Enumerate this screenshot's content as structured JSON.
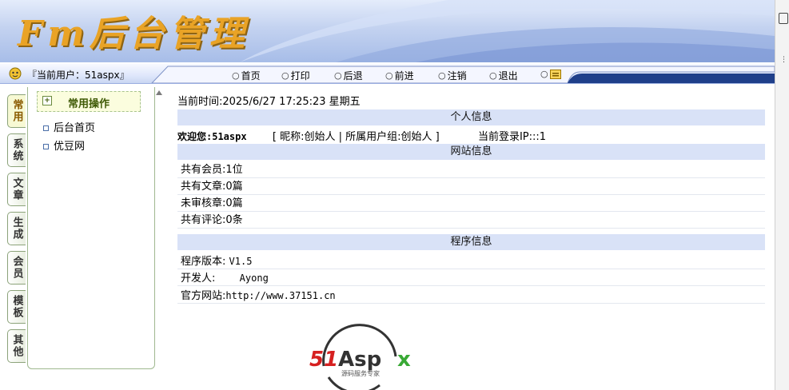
{
  "app": {
    "logo_text": "Fm后台管理",
    "current_user_label": "『当前用户：51aspx』"
  },
  "nav": {
    "items": [
      {
        "label": "首页"
      },
      {
        "label": "打印"
      },
      {
        "label": "后退"
      },
      {
        "label": "前进"
      },
      {
        "label": "注销"
      },
      {
        "label": "退出"
      }
    ]
  },
  "sidebar": {
    "tabs": [
      "常用",
      "系统",
      "文章",
      "生成",
      "会员",
      "模板",
      "其他"
    ],
    "panel_title": "常用操作",
    "items": [
      {
        "label": "后台首页"
      },
      {
        "label": "优豆网"
      }
    ]
  },
  "main": {
    "current_time": "当前时间:2025/6/27 17:25:23 星期五",
    "personal_header": "个人信息",
    "welcome": "欢迎您:51aspx",
    "nickname_part": "[  昵称:创始人  |  所属用户组:创始人  ]",
    "login_ip": "当前登录IP:::1",
    "site_header": "网站信息",
    "site_rows": [
      "共有会员:1位",
      "共有文章:0篇",
      "未审核章:0篇",
      "共有评论:0条"
    ],
    "program_header": "程序信息",
    "version_label": "程序版本:",
    "version_value": "V1.5",
    "developer_label": "开发人:",
    "developer_value": "Ayong",
    "website_label": "官方网站:",
    "website_value": "http://www.37151.cn"
  },
  "footer_logo": {
    "brand_red": "51",
    "brand_dark": "Aspx",
    "tagline": "源码服务专家",
    "colors": {
      "red": "#d62020",
      "dark": "#333333",
      "green": "#39a935"
    }
  }
}
